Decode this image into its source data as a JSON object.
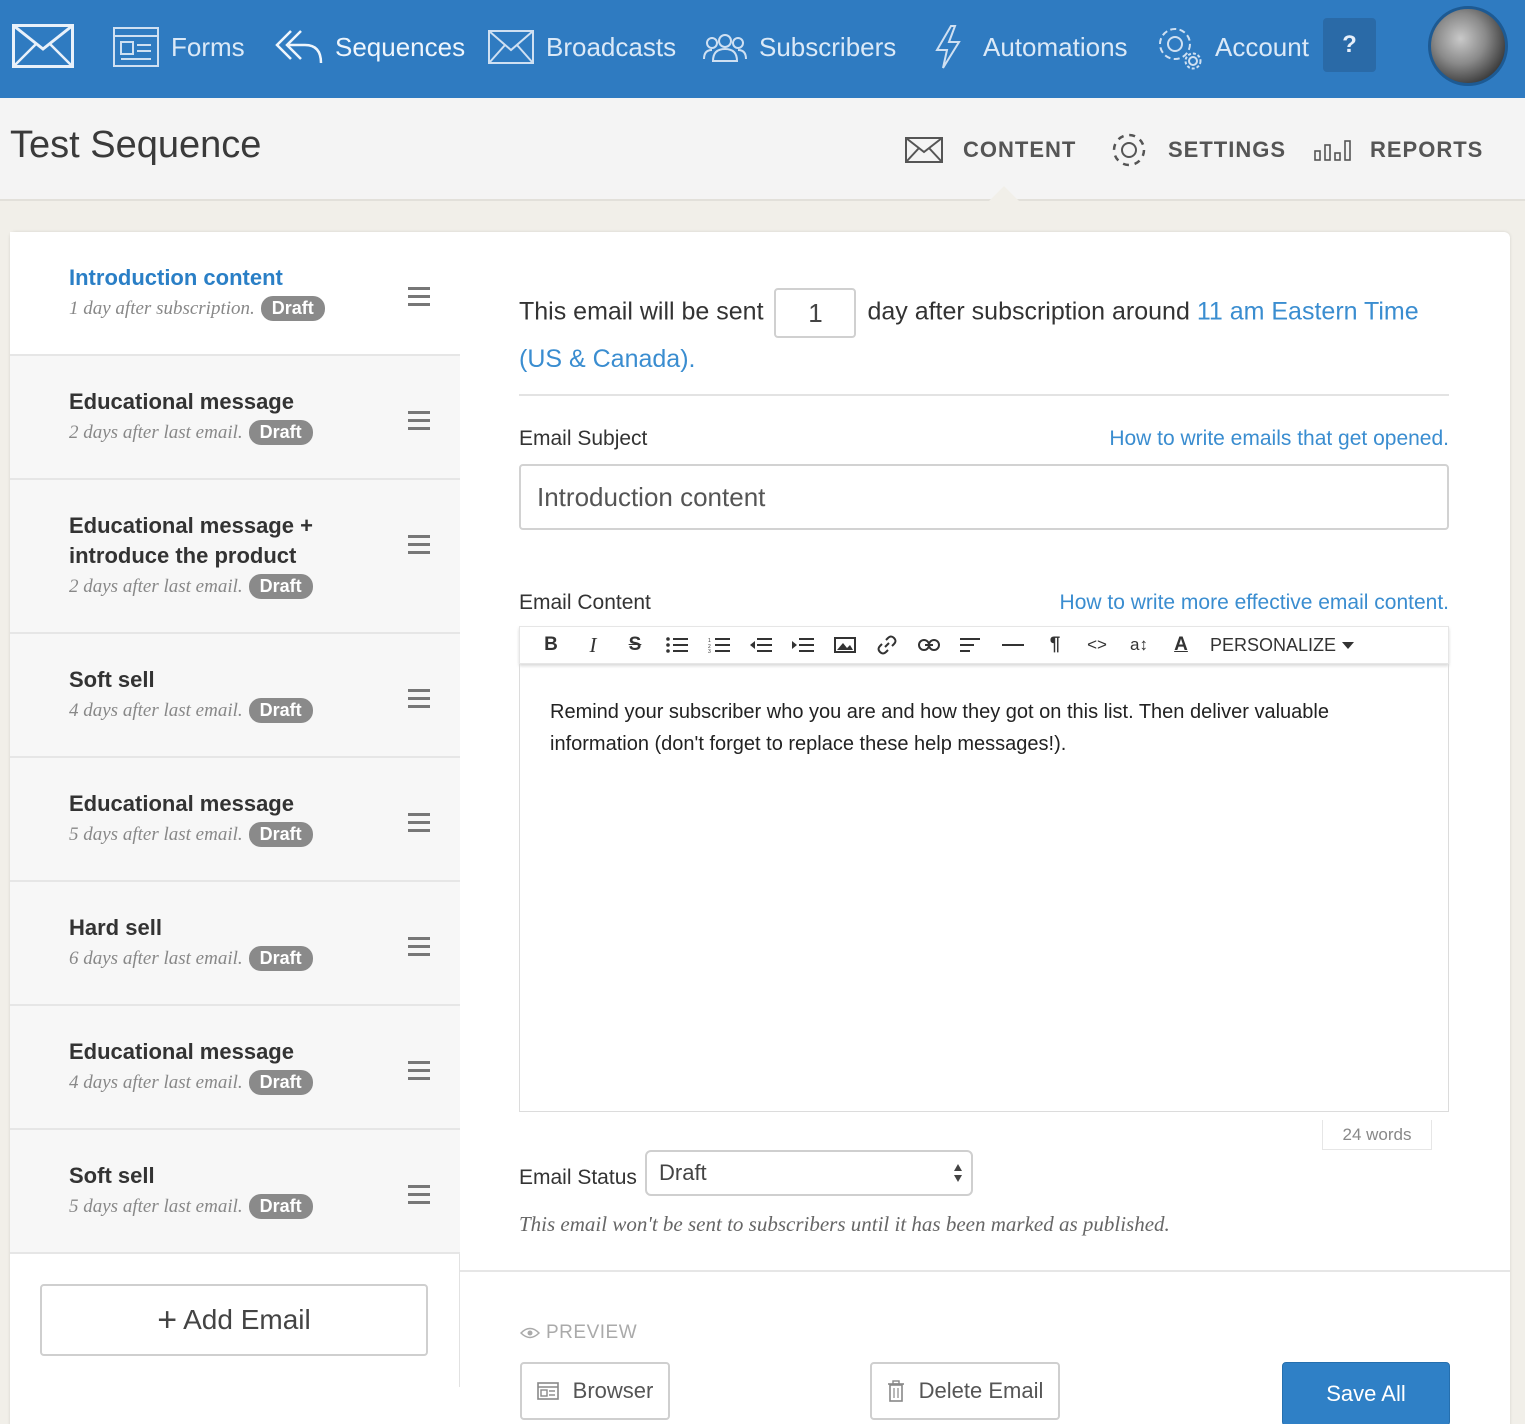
{
  "nav": {
    "items": [
      {
        "label": "Forms",
        "icon": "forms-icon"
      },
      {
        "label": "Sequences",
        "icon": "sequences-icon"
      },
      {
        "label": "Broadcasts",
        "icon": "broadcasts-icon"
      },
      {
        "label": "Subscribers",
        "icon": "subscribers-icon"
      },
      {
        "label": "Automations",
        "icon": "automations-icon"
      },
      {
        "label": "Account",
        "icon": "account-icon"
      }
    ],
    "help_label": "?",
    "accent": "#2f7bc1"
  },
  "page": {
    "title": "Test Sequence",
    "tabs": [
      {
        "label": "CONTENT",
        "icon": "envelope-icon",
        "active": true
      },
      {
        "label": "SETTINGS",
        "icon": "gear-icon",
        "active": false
      },
      {
        "label": "REPORTS",
        "icon": "bar-chart-icon",
        "active": false
      }
    ]
  },
  "sequence": {
    "emails": [
      {
        "title": "Introduction content",
        "meta": "1 day after subscription.",
        "status": "Draft",
        "active": true
      },
      {
        "title": "Educational message",
        "meta": "2 days after last email.",
        "status": "Draft"
      },
      {
        "title": "Educational message + introduce the product",
        "meta": "2 days after last email.",
        "status": "Draft"
      },
      {
        "title": "Soft sell",
        "meta": "4 days after last email.",
        "status": "Draft"
      },
      {
        "title": "Educational message",
        "meta": "5 days after last email.",
        "status": "Draft"
      },
      {
        "title": "Hard sell",
        "meta": "6 days after last email.",
        "status": "Draft"
      },
      {
        "title": "Educational message",
        "meta": "4 days after last email.",
        "status": "Draft"
      },
      {
        "title": "Soft sell",
        "meta": "5 days after last email.",
        "status": "Draft"
      }
    ],
    "add_email_label": "Add Email"
  },
  "editor": {
    "schedule_prefix": "This email will be sent",
    "schedule_days": "1",
    "schedule_suffix": "day after subscription around",
    "schedule_time_link": "11 am Eastern Time (US & Canada).",
    "subject_label": "Email Subject",
    "subject_help": "How to write emails that get opened.",
    "subject_value": "Introduction content",
    "content_label": "Email Content",
    "content_help": "How to write more effective email content.",
    "toolbar": {
      "bold": "B",
      "italic": "I",
      "strike": "S",
      "personalize": "PERSONALIZE"
    },
    "body": "Remind your subscriber who you are and how they got on this list. Then deliver valuable information (don't forget to replace these help messages!).",
    "word_count": "24 words",
    "status_label": "Email Status",
    "status_value": "Draft",
    "status_note": "This email won't be sent to subscribers until it has been marked as published.",
    "preview_label": "PREVIEW",
    "browser_label": "Browser",
    "delete_label": "Delete Email",
    "save_label": "Save All"
  }
}
